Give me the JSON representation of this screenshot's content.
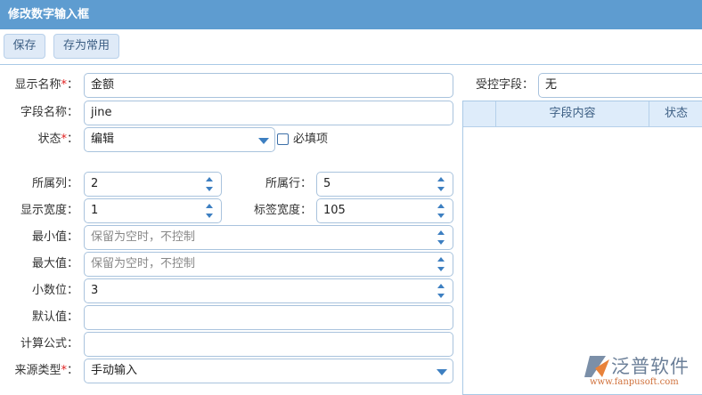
{
  "title": "修改数字输入框",
  "toolbar": {
    "save": "保存",
    "save_common": "存为常用"
  },
  "form": {
    "display_name": {
      "label": "显示名称",
      "req": "*",
      "colon": "：",
      "value": "金额"
    },
    "field_name": {
      "label": "字段名称：",
      "value": "jine"
    },
    "status": {
      "label": "状态",
      "req": "*",
      "colon": "：",
      "value": "编辑"
    },
    "required": {
      "label": "必填项"
    },
    "column": {
      "label": "所属列：",
      "value": "2"
    },
    "row": {
      "label": "所属行：",
      "value": "5"
    },
    "display_width": {
      "label": "显示宽度：",
      "value": "1"
    },
    "label_width": {
      "label": "标签宽度：",
      "value": "105"
    },
    "min": {
      "label": "最小值：",
      "placeholder": "保留为空时，不控制"
    },
    "max": {
      "label": "最大值：",
      "placeholder": "保留为空时，不控制"
    },
    "decimals": {
      "label": "小数位：",
      "value": "3"
    },
    "default": {
      "label": "默认值：",
      "value": ""
    },
    "formula": {
      "label": "计算公式：",
      "value": ""
    },
    "source_type": {
      "label": "来源类型",
      "req": "*",
      "colon": "：",
      "value": "手动输入"
    }
  },
  "controlled": {
    "label": "受控字段：",
    "value": "无",
    "columns": [
      "",
      "字段内容",
      "状态"
    ]
  },
  "logo": {
    "name": "泛普软件",
    "url": "www.fanpusoft.com"
  }
}
